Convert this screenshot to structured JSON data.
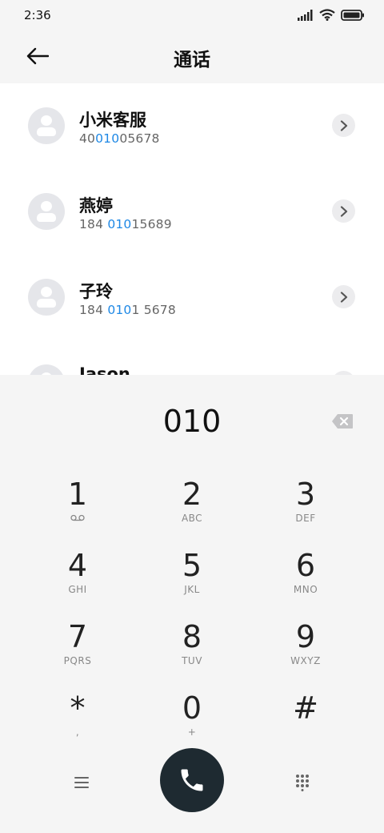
{
  "status_bar": {
    "time": "2:36",
    "icons": [
      "signal-icon",
      "wifi-icon",
      "battery-icon"
    ]
  },
  "header": {
    "title": "通话",
    "back_icon": "back-arrow-icon"
  },
  "contacts": [
    {
      "name": "小米客服",
      "number_parts": [
        "40",
        "010",
        "05678"
      ]
    },
    {
      "name": "燕婷",
      "number_parts": [
        "184 ",
        "010",
        "15689"
      ]
    },
    {
      "name": "子玲",
      "number_parts": [
        "184 ",
        "010",
        "1 5678"
      ]
    },
    {
      "name": "Jason",
      "number_parts": [
        "",
        "",
        ""
      ]
    }
  ],
  "dialer": {
    "dialed_number": "010",
    "keys": [
      {
        "digit": "1",
        "letters": ""
      },
      {
        "digit": "2",
        "letters": "ABC"
      },
      {
        "digit": "3",
        "letters": "DEF"
      },
      {
        "digit": "4",
        "letters": "GHI"
      },
      {
        "digit": "5",
        "letters": "JKL"
      },
      {
        "digit": "6",
        "letters": "MNO"
      },
      {
        "digit": "7",
        "letters": "PQRS"
      },
      {
        "digit": "8",
        "letters": "TUV"
      },
      {
        "digit": "9",
        "letters": "WXYZ"
      },
      {
        "digit": "*",
        "letters": ","
      },
      {
        "digit": "0",
        "letters": "+"
      },
      {
        "digit": "#",
        "letters": ""
      }
    ]
  },
  "colors": {
    "highlight": "#1e88e5",
    "call_button": "#1e2a31",
    "list_background": "#ffffff",
    "dialer_background": "#f5f5f5"
  }
}
